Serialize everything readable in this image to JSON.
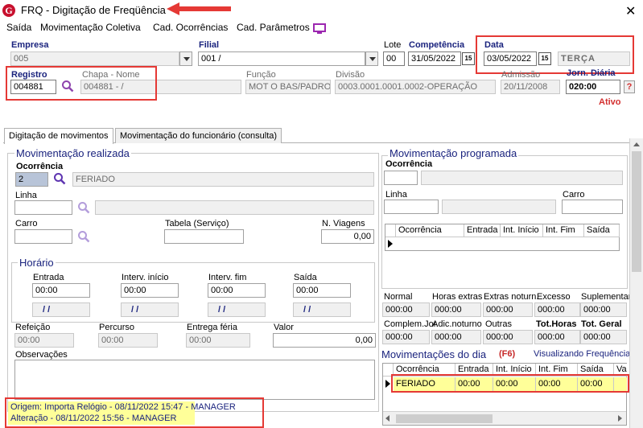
{
  "window": {
    "title": "FRQ - Digitação de Freqüência",
    "close_glyph": "✕",
    "app_icon_letter": "G"
  },
  "menu": [
    "Saída",
    "Movimentação Coletiva",
    "Cad. Ocorrências",
    "Cad. Parâmetros"
  ],
  "header": {
    "empresa_label": "Empresa",
    "empresa_value": "005",
    "filial_label": "Filial",
    "filial_value": "001 /",
    "lote_label": "Lote",
    "lote_value": "00",
    "competencia_label": "Competência",
    "competencia_value": "31/05/2022",
    "data_label": "Data",
    "data_value": "03/05/2022",
    "weekday_value": "TERÇA",
    "cal_glyph": "15",
    "registro_label": "Registro",
    "registro_value": "004881",
    "chapa_nome_label": "Chapa  -  Nome",
    "chapa_nome_value": "004881 - /",
    "funcao_label": "Função",
    "funcao_value": "MOT O BAS/PADRO",
    "divisao_label": "Divisão",
    "divisao_value": "0003.0001.0001.0002-OPERAÇÃO",
    "admissao_label": "Admissão",
    "admissao_value": "20/11/2008",
    "jorn_label": "Jorn. Diária",
    "jorn_value": "020:00",
    "help_glyph": "?",
    "status_text": "Ativo"
  },
  "tabs": [
    "Digitação de movimentos",
    "Movimentação do funcionário (consulta)"
  ],
  "realizada": {
    "title": "Movimentação realizada",
    "ocorrencia_label": "Ocorrência",
    "ocorrencia_code": "2",
    "ocorrencia_desc": "FERIADO",
    "linha_label": "Linha",
    "carro_label": "Carro",
    "tabela_label": "Tabela (Serviço)",
    "viagens_label": "N. Viagens",
    "viagens_value": "0,00",
    "horario_title": "Horário",
    "horario": [
      {
        "label": "Entrada",
        "value": "00:00",
        "sub": "/ /"
      },
      {
        "label": "Interv. início",
        "value": "00:00",
        "sub": "/ /"
      },
      {
        "label": "Interv. fim",
        "value": "00:00",
        "sub": "/ /"
      },
      {
        "label": "Saída",
        "value": "00:00",
        "sub": "/ /"
      }
    ],
    "refeicao_label": "Refeição",
    "refeicao_value": "00:00",
    "percurso_label": "Percurso",
    "percurso_value": "00:00",
    "entrega_label": "Entrega féria",
    "entrega_value": "00:00",
    "valor_label": "Valor",
    "valor_value": "0,00",
    "obs_label": "Observações"
  },
  "programada": {
    "title": "Movimentação programada",
    "ocorrencia_label": "Ocorrência",
    "linha_label": "Linha",
    "carro_label": "Carro",
    "grid_headers": [
      "Ocorrência",
      "Entrada",
      "Int. Início",
      "Int. Fim",
      "Saída"
    ]
  },
  "totais": {
    "row1": [
      {
        "label": "Normal",
        "value": "000:00"
      },
      {
        "label": "Horas extras",
        "value": "000:00"
      },
      {
        "label": "Extras noturn.",
        "value": "000:00"
      },
      {
        "label": "Excesso",
        "value": "000:00"
      },
      {
        "label": "Suplementar",
        "value": "000:00"
      }
    ],
    "row2": [
      {
        "label": "Complem.Jor.",
        "value": "000:00"
      },
      {
        "label": "Adic.noturno",
        "value": "000:00"
      },
      {
        "label": "Outras",
        "value": "000:00"
      },
      {
        "label": "Tot.Horas",
        "value": "000:00"
      },
      {
        "label": "Tot. Geral",
        "value": "000:00"
      }
    ]
  },
  "dia": {
    "title": "Movimentações do dia",
    "shortcut": "(F6)",
    "view_link": "Visualizando Frequência",
    "grid_headers": [
      "Ocorrência",
      "Entrada",
      "Int. Início",
      "Int. Fim",
      "Saída",
      "Va"
    ],
    "row": [
      "FERIADO",
      "00:00",
      "00:00",
      "00:00",
      "00:00",
      ""
    ]
  },
  "footer": {
    "origem": "Origem: Importa Relógio - 08/11/2022 15:47 - MANAGER",
    "alteracao": "Alteração - 08/11/2022 15:56 - MANAGER"
  },
  "colors": {
    "annotation_red": "#e53935",
    "highlight_yellow": "#ffff99",
    "navy_label": "#1a237e",
    "status_red": "#d32f2f"
  }
}
